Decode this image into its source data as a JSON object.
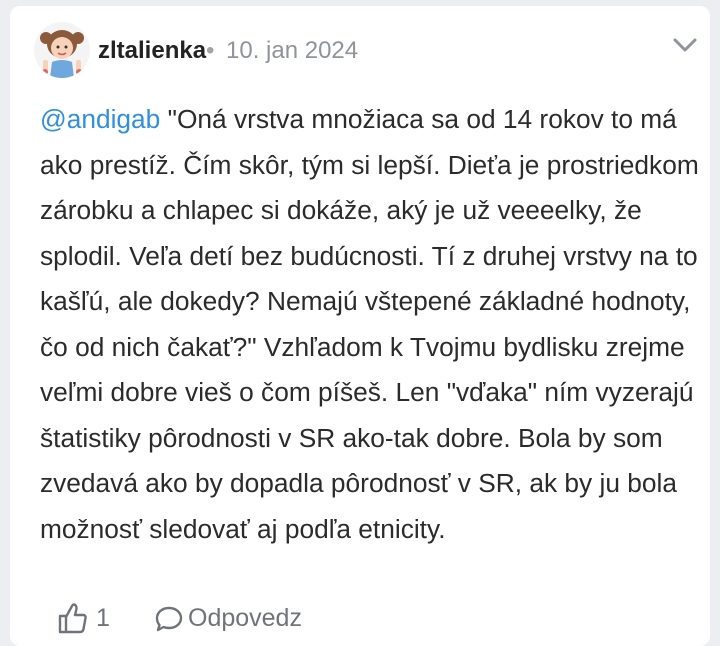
{
  "post": {
    "author": "zltalienka",
    "separator": "•",
    "date": "10. jan 2024",
    "mention": "@andigab",
    "text": " \"Oná vrstva množiaca sa od 14 rokov to má ako prestíž. Čím skôr, tým si lepší. Dieťa je prostriedkom zárobku a chlapec si dokáže, aký je už veeeelky, že splodil. Veľa detí bez budúcnosti. Tí z druhej vrstvy na to kašľú, ale dokedy? Nemajú vštepené základné hodnoty, čo od nich čakať?\" Vzhľadom k Tvojmu bydlisku zrejme veľmi dobre vieš o čom píšeš. Len \"vďaka\" ním vyzerajú štatistiky pôrodnosti v SR ako-tak dobre. Bola by som zvedavá ako by dopadla pôrodnosť v SR, ak by ju bola možnosť sledovať aj podľa etnicity."
  },
  "actions": {
    "like_count": "1",
    "reply_label": "Odpovedz"
  },
  "icons": {
    "like": "thumbs-up-icon",
    "reply": "speech-bubble-icon",
    "menu": "chevron-down-icon"
  },
  "colors": {
    "mention": "#2f8fe0",
    "muted": "#8f949a",
    "background": "#eceef1"
  }
}
